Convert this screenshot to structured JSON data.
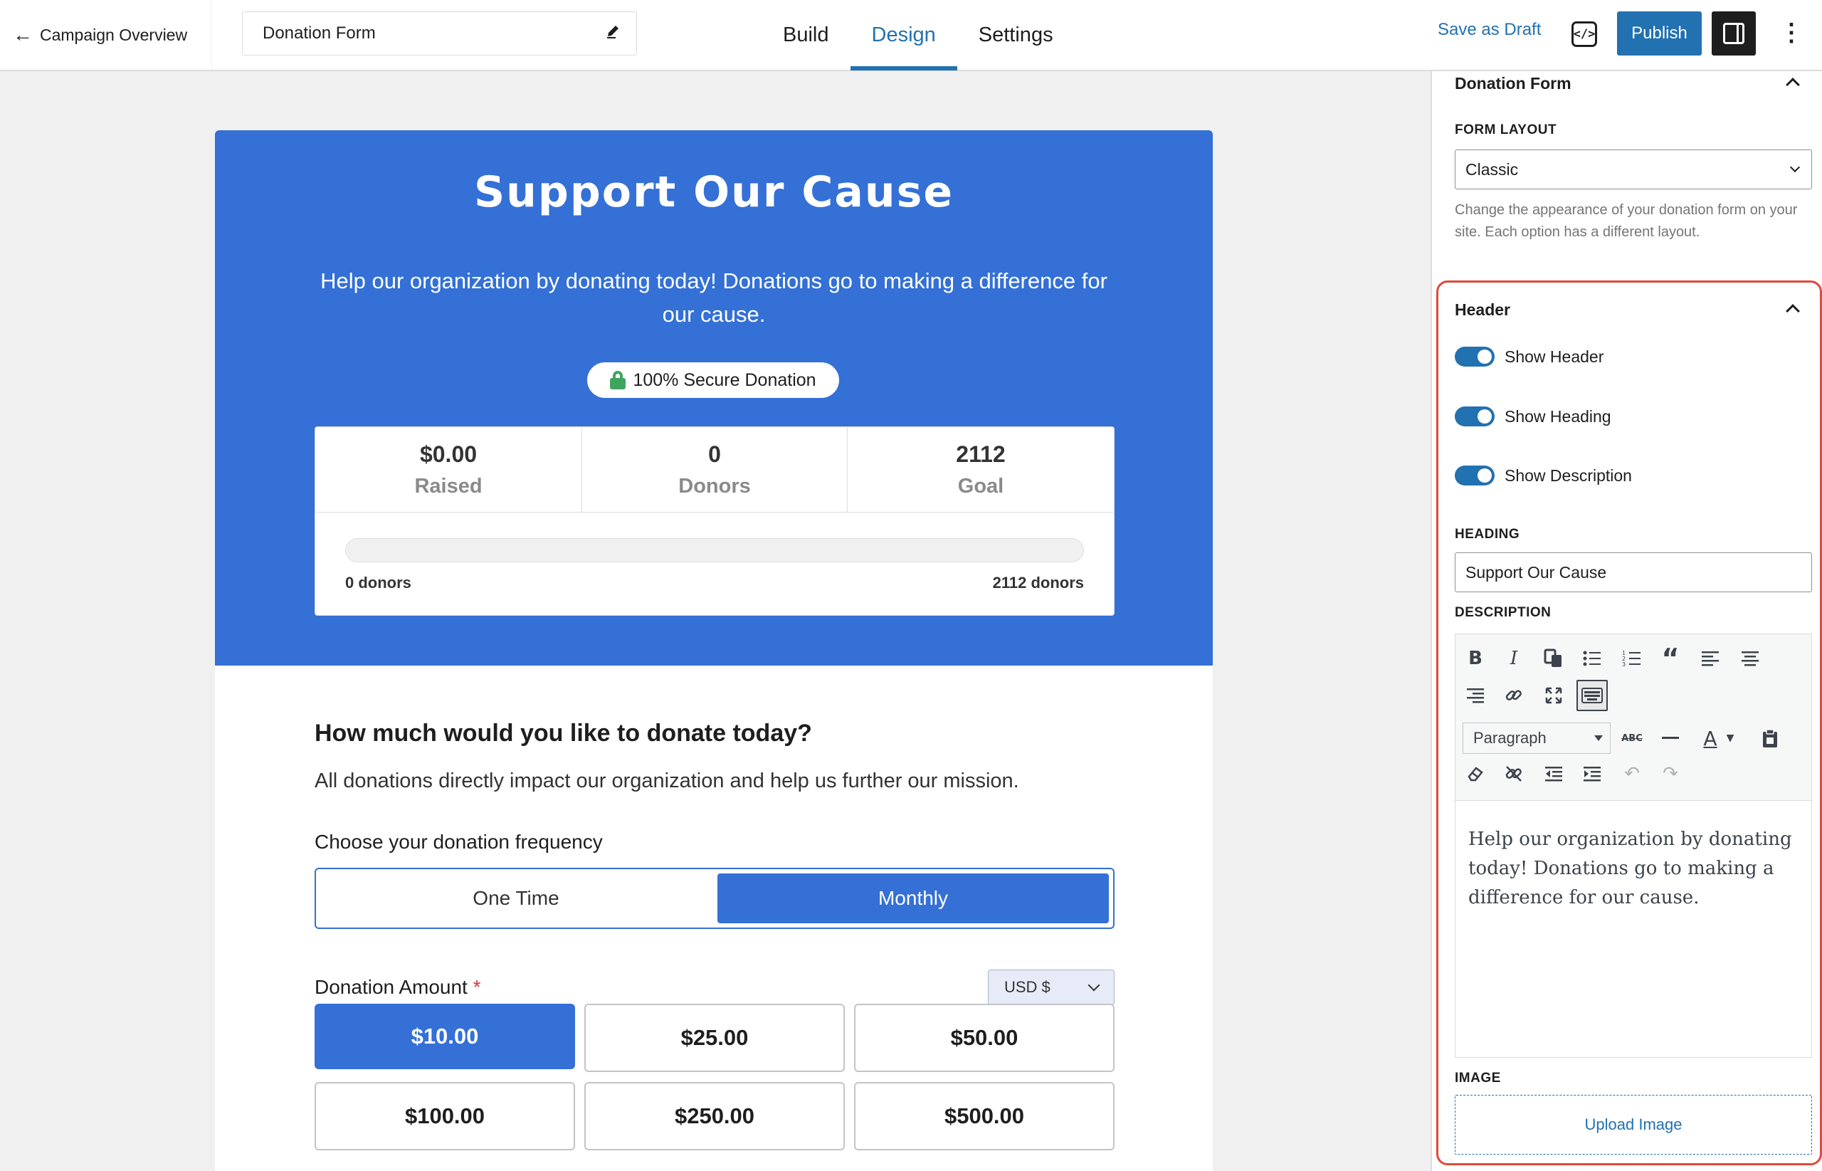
{
  "topbar": {
    "back_label": "Campaign Overview",
    "form_name": "Donation Form",
    "tabs": [
      {
        "label": "Build"
      },
      {
        "label": "Design",
        "active": true
      },
      {
        "label": "Settings"
      }
    ],
    "save_draft_label": "Save as Draft",
    "publish_label": "Publish",
    "more_icon": "⋮",
    "code_icon": "</>"
  },
  "form": {
    "heading": "Support Our Cause",
    "description": "Help our organization by donating today! Donations go to making a difference for our cause.",
    "secure_badge": "100% Secure Donation",
    "stats": [
      {
        "value": "$0.00",
        "label": "Raised"
      },
      {
        "value": "0",
        "label": "Donors"
      },
      {
        "value": "2112",
        "label": "Goal"
      }
    ],
    "progress": {
      "fraction": 0,
      "left_label": "0 donors",
      "right_label": "2112 donors"
    },
    "question": "How much would you like to donate today?",
    "question_sub": "All donations directly impact our organization and help us further our mission.",
    "frequency_label": "Choose your donation frequency",
    "frequency_options": [
      "One Time",
      "Monthly"
    ],
    "frequency_selected": "Monthly",
    "amount_label": "Donation Amount",
    "required_marker": "*",
    "currency": "USD $",
    "amounts": [
      "$10.00",
      "$25.00",
      "$50.00",
      "$100.00",
      "$250.00",
      "$500.00"
    ],
    "amount_selected": "$10.00"
  },
  "sidebar": {
    "donation_form_section": "Donation Form",
    "form_layout_label": "FORM LAYOUT",
    "form_layout_value": "Classic",
    "form_layout_help": "Change the appearance of your donation form on your site. Each option has a different layout.",
    "header_section": "Header",
    "toggles": [
      {
        "label": "Show Header",
        "on": true
      },
      {
        "label": "Show Heading",
        "on": true
      },
      {
        "label": "Show Description",
        "on": true
      }
    ],
    "heading_label": "HEADING",
    "heading_value": "Support Our Cause",
    "description_label": "DESCRIPTION",
    "paragraph_format": "Paragraph",
    "editor_text": "Help our organization by donating today! Donations go to making a difference for our cause.",
    "image_label": "IMAGE",
    "upload_label": "Upload Image"
  },
  "colors": {
    "accent": "#2271b1",
    "hero_blue": "#3470d6",
    "highlight_border": "#e2493a",
    "secure_green": "#3fa55e"
  }
}
